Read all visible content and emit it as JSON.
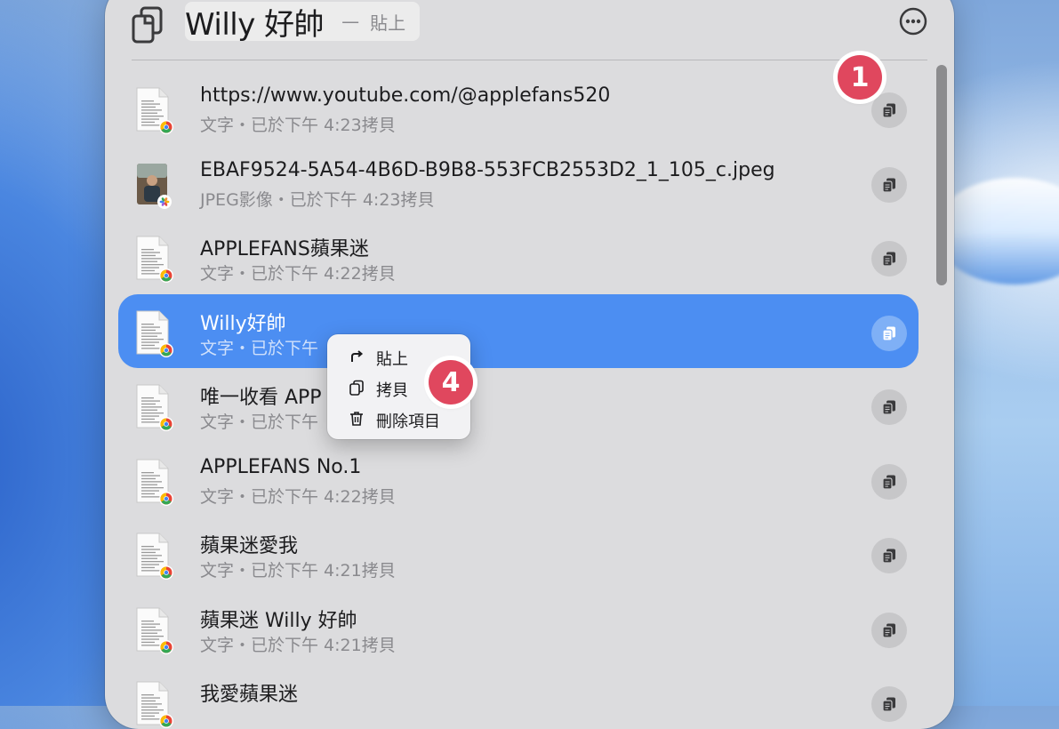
{
  "header": {
    "title": "Willy 好帥",
    "separator": "—",
    "paste_hint": "貼上"
  },
  "items": [
    {
      "title": "https://www.youtube.com/@applefans520",
      "subtitle": "文字・已於下午 4:23拷貝",
      "thumb": "chrome-doc"
    },
    {
      "title": "EBAF9524-5A54-4B6D-B9B8-553FCB2553D2_1_105_c.jpeg",
      "subtitle": "JPEG影像・已於下午 4:23拷貝",
      "thumb": "photo"
    },
    {
      "title": "APPLEFANS蘋果迷",
      "subtitle": "文字・已於下午 4:22拷貝",
      "thumb": "chrome-doc"
    },
    {
      "title": "Willy好帥",
      "subtitle": "文字・已於下午",
      "thumb": "chrome-doc",
      "selected": true
    },
    {
      "title": "唯一收看 APP",
      "subtitle": "文字・已於下午",
      "thumb": "chrome-doc"
    },
    {
      "title": "APPLEFANS No.1",
      "subtitle": "文字・已於下午 4:22拷貝",
      "thumb": "chrome-doc"
    },
    {
      "title": "蘋果迷愛我",
      "subtitle": "文字・已於下午 4:21拷貝",
      "thumb": "chrome-doc"
    },
    {
      "title": "蘋果迷 Willy 好帥",
      "subtitle": "文字・已於下午 4:21拷貝",
      "thumb": "chrome-doc"
    },
    {
      "title": "我愛蘋果迷",
      "subtitle": "",
      "thumb": "chrome-doc"
    }
  ],
  "context_menu": {
    "items": [
      {
        "label": "貼上",
        "icon": "paste-arrow-icon"
      },
      {
        "label": "拷貝",
        "icon": "copy-icon"
      },
      {
        "label": "刪除項目",
        "icon": "trash-icon"
      }
    ]
  },
  "annotations": {
    "badge_1": "1",
    "badge_4": "4"
  },
  "colors": {
    "selected": "#4c8ef2",
    "badge": "#e0475e",
    "panel": "#dcdcde"
  }
}
